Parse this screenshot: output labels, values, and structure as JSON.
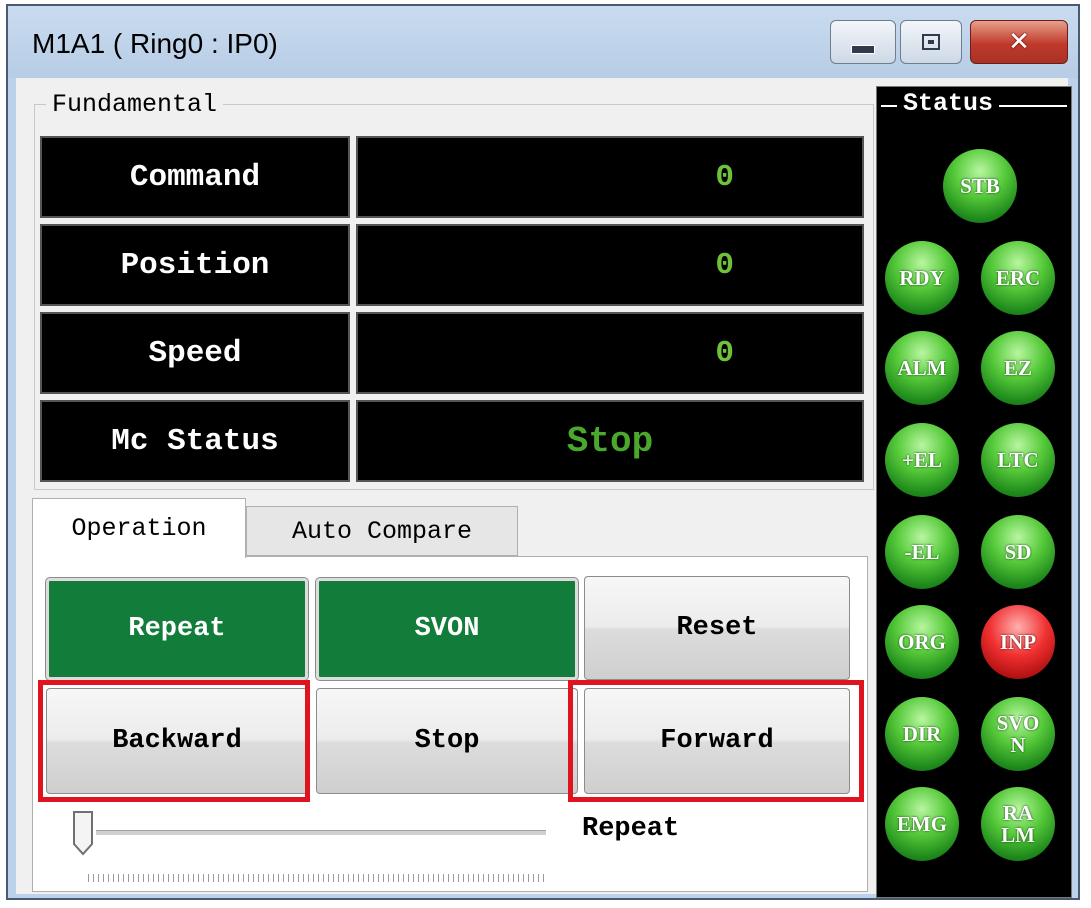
{
  "window": {
    "title": "M1A1 ( Ring0 : IP0)"
  },
  "fundamental": {
    "legend": "Fundamental",
    "rows": [
      {
        "label": "Command",
        "value": "0"
      },
      {
        "label": "Position",
        "value": "0"
      },
      {
        "label": "Speed",
        "value": "0"
      },
      {
        "label": "Mc Status",
        "value": "Stop"
      }
    ]
  },
  "tabs": [
    {
      "label": "Operation",
      "active": true
    },
    {
      "label": "Auto Compare",
      "active": false
    }
  ],
  "operation": {
    "buttons": {
      "repeat": "Repeat",
      "svon": "SVON",
      "reset": "Reset",
      "backward": "Backward",
      "stop": "Stop",
      "forward": "Forward"
    },
    "slider": {
      "caption": "Repeat",
      "value_fraction": 0.0
    }
  },
  "status": {
    "legend": "Status",
    "leds": [
      {
        "label": "STB",
        "state": "on"
      },
      {
        "label": "RDY",
        "state": "on"
      },
      {
        "label": "ERC",
        "state": "on"
      },
      {
        "label": "ALM",
        "state": "on"
      },
      {
        "label": "EZ",
        "state": "on"
      },
      {
        "label": "+EL",
        "state": "on"
      },
      {
        "label": "LTC",
        "state": "on"
      },
      {
        "label": "-EL",
        "state": "on"
      },
      {
        "label": "SD",
        "state": "on"
      },
      {
        "label": "ORG",
        "state": "on"
      },
      {
        "label": "INP",
        "state": "off"
      },
      {
        "label": "DIR",
        "state": "on"
      },
      {
        "label": "SVON",
        "state": "on"
      },
      {
        "label": "EMG",
        "state": "on"
      },
      {
        "label": "RALM",
        "state": "on"
      }
    ]
  },
  "colors": {
    "active_button": "#127d3a",
    "value_text": "#6ec23a",
    "highlight": "#e0141e",
    "led_on": "#56c93a",
    "led_off": "#f03030"
  }
}
